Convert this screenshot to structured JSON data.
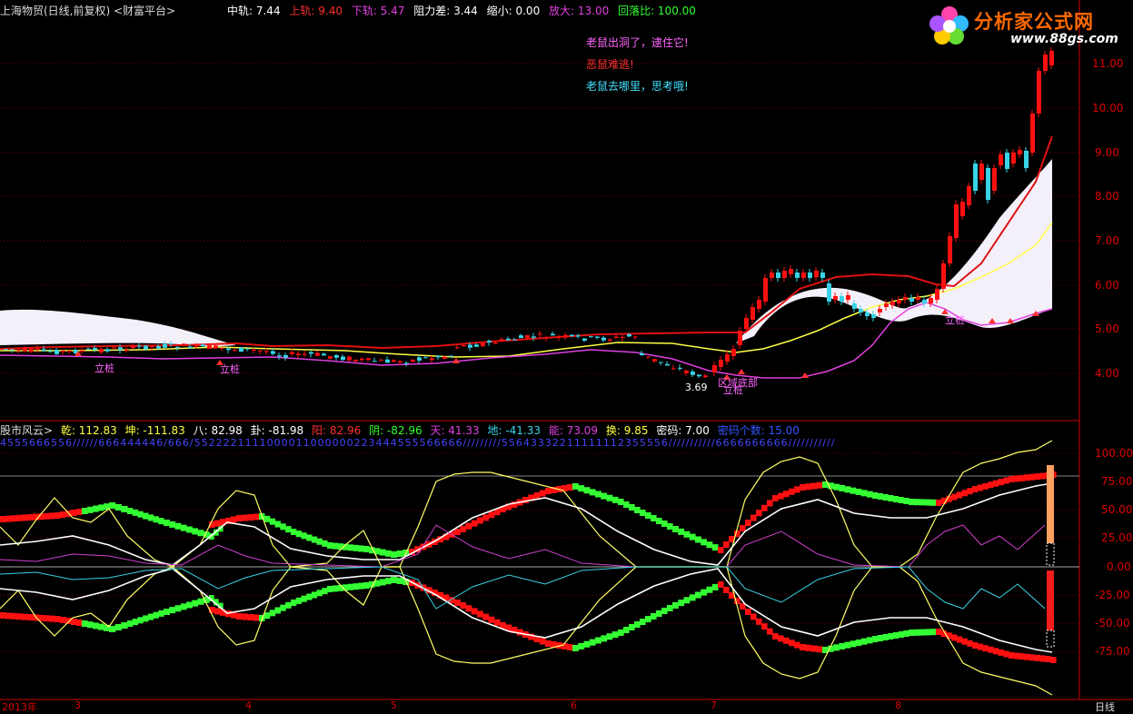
{
  "header": {
    "title": "上海物贸(日线,前复权) <财富平台>",
    "mid_label": "中轨: 7.44",
    "upper_label": "上轨: 9.40",
    "lower_label": "下轨: 5.47",
    "resist_label": "阻力差: 3.44",
    "shrink_label": "缩小: 0.00",
    "expand_label": "放大: 13.00",
    "retrace_label": "回落比: 100.00"
  },
  "logo": {
    "title": "分析家公式网",
    "url": "www.88gs.com"
  },
  "notes": [
    "老鼠出洞了，逮住它!",
    "恶鼠难逃!",
    "老鼠去哪里，思考哦!"
  ],
  "price_axis": [
    "11.00",
    "10.00",
    "9.00",
    "8.00",
    "7.00",
    "6.00",
    "5.00",
    "4.00"
  ],
  "annotations": {
    "low_price": "3.69",
    "pile": "立桩",
    "zone": "区域底部"
  },
  "indicator": {
    "name": "股市风云>",
    "qian": "乾: 112.83",
    "kun": "坤: -111.83",
    "ba": "八: 82.98",
    "gua": "卦: -81.98",
    "yang": "阳: 82.96",
    "yin": "阴: -82.96",
    "tian": "天: 41.33",
    "di": "地: -41.33",
    "neng": "能: 73.09",
    "huan": "换: 9.85",
    "code": "密码: 7.00",
    "code_count": "密码个数: 15.00",
    "digit_row": "4555666556//////666444446/666/5522221111000011000000223444555566666/////////55643332211111112355556///////////6666666666///////////"
  },
  "indicator_axis": [
    "100.00",
    "75.00",
    "50.00",
    "25.00",
    "0.00",
    "-25.00",
    "-50.00",
    "-75.00"
  ],
  "time_axis": [
    "2013年",
    "3",
    "4",
    "5",
    "6",
    "7",
    "8",
    "日线"
  ],
  "colors": {
    "grid": "#7a0000",
    "red": "#ff1010",
    "cyan": "#39d3e6",
    "yellow": "#ffff44",
    "magenta": "#e040e0",
    "green": "#33ff33",
    "white": "#ffffff"
  }
}
